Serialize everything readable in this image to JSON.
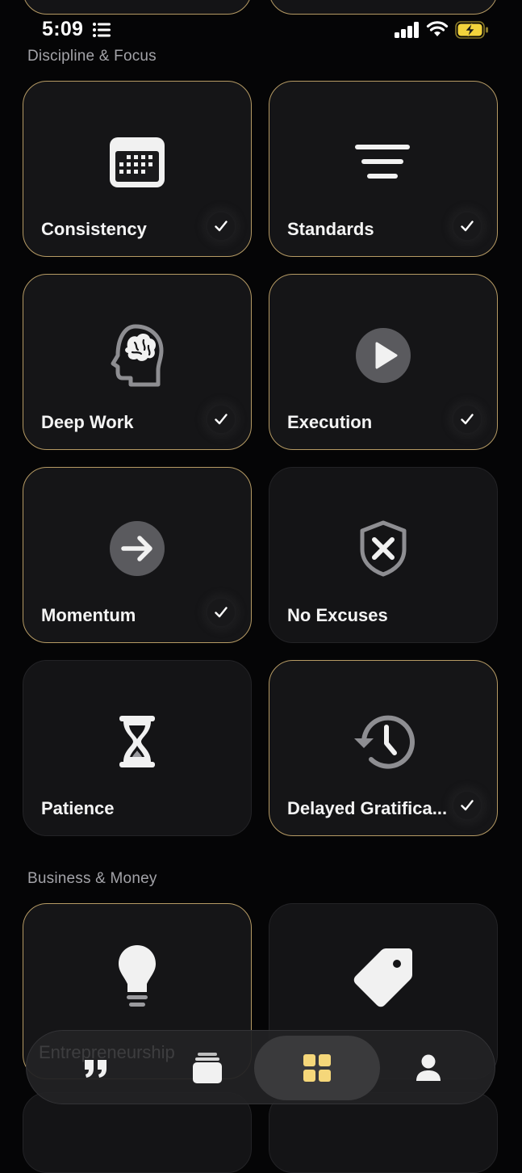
{
  "status_bar": {
    "time": "5:09"
  },
  "sections": [
    {
      "title": "Discipline & Focus",
      "items": [
        {
          "label": "Consistency",
          "icon": "calendar-icon",
          "selected": true
        },
        {
          "label": "Standards",
          "icon": "lines-icon",
          "selected": true
        },
        {
          "label": "Deep Work",
          "icon": "brain-head-icon",
          "selected": true
        },
        {
          "label": "Execution",
          "icon": "play-icon",
          "selected": true
        },
        {
          "label": "Momentum",
          "icon": "arrow-right-icon",
          "selected": true
        },
        {
          "label": "No Excuses",
          "icon": "shield-x-icon",
          "selected": false
        },
        {
          "label": "Patience",
          "icon": "hourglass-icon",
          "selected": false
        },
        {
          "label": "Delayed Gratifica...",
          "icon": "history-clock-icon",
          "selected": true
        }
      ]
    },
    {
      "title": "Business & Money",
      "items": [
        {
          "label": "Entrepreneurship",
          "icon": "lightbulb-icon",
          "selected": true
        },
        {
          "label": "",
          "icon": "tag-icon",
          "selected": false
        }
      ]
    }
  ],
  "tab_bar": {
    "tabs": [
      {
        "name": "quotes",
        "icon": "quote-icon",
        "active": false
      },
      {
        "name": "cards",
        "icon": "cards-stack-icon",
        "active": false
      },
      {
        "name": "categories",
        "icon": "grid-icon",
        "active": true
      },
      {
        "name": "profile",
        "icon": "person-icon",
        "active": false
      }
    ]
  },
  "colors": {
    "background": "#050506",
    "card": "#141416",
    "selected_border": "#b59a64",
    "active_tab_icon": "#f5d77a",
    "battery_fill": "#f2d33c"
  }
}
